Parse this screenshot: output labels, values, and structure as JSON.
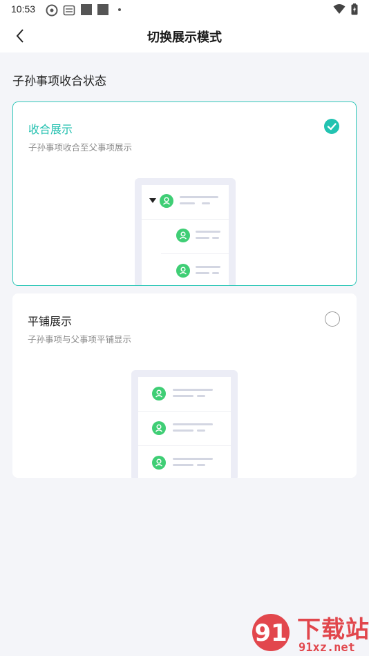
{
  "status_bar": {
    "time": "10:53"
  },
  "header": {
    "title": "切换展示模式"
  },
  "section": {
    "label": "子孙事项收合状态"
  },
  "options": [
    {
      "name": "收合展示",
      "description": "子孙事项收合至父事项展示",
      "selected": true
    },
    {
      "name": "平铺展示",
      "description": "子孙事项与父事项平铺显示",
      "selected": false
    }
  ],
  "watermark": {
    "brand": "下载站",
    "site": "91xz.net"
  },
  "colors": {
    "accent": "#22c3b1",
    "avatar": "#3fce75",
    "background": "#f4f5f9"
  }
}
